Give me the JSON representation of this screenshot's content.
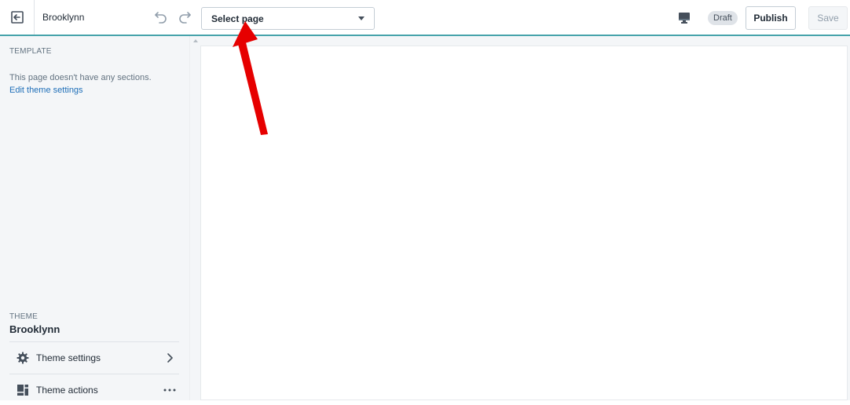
{
  "topbar": {
    "theme_name": "Brooklynn",
    "page_select": {
      "selected": "Select page"
    },
    "draft_badge": "Draft",
    "publish_label": "Publish",
    "save_label": "Save"
  },
  "sidebar": {
    "template_heading": "TEMPLATE",
    "no_sections_text": "This page doesn't have any sections.",
    "edit_theme_link": "Edit theme settings",
    "theme_heading": "THEME",
    "theme_title": "Brooklynn",
    "items": [
      {
        "label": "Theme settings",
        "icon": "gear-icon",
        "end_icon": "chevron-right-icon"
      },
      {
        "label": "Theme actions",
        "icon": "layout-icon",
        "end_icon": "more-horizontal-icon"
      }
    ]
  },
  "colors": {
    "accent_border": "#47a3ab",
    "link": "#1f6fb8",
    "sidebar_bg": "#f4f6f8",
    "annotation_arrow": "#e60000"
  }
}
